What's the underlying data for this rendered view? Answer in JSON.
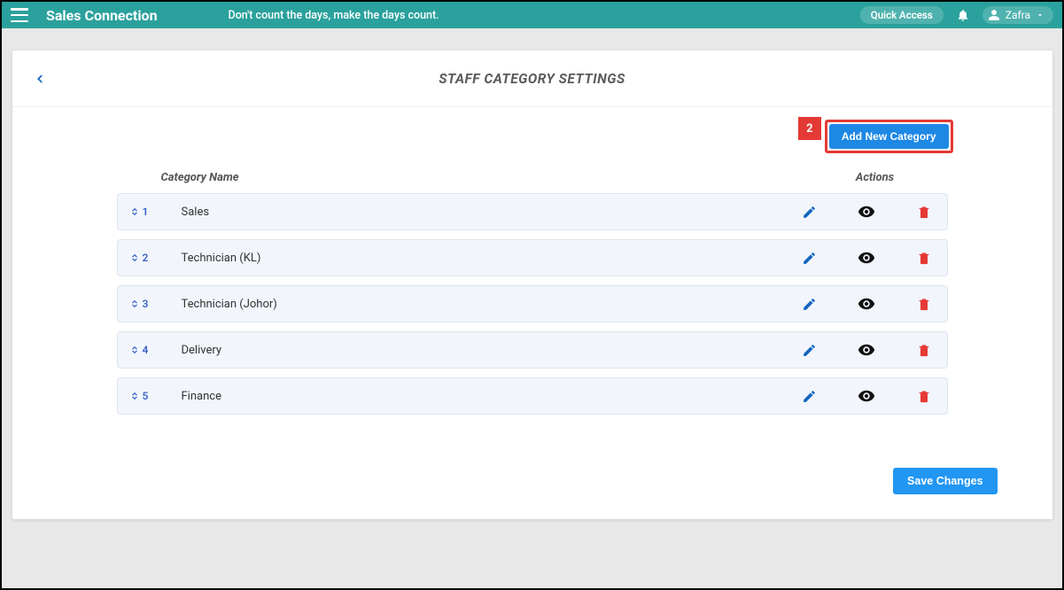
{
  "header": {
    "brand": "Sales Connection",
    "tagline": "Don't count the days, make the days count.",
    "quick_access": "Quick Access",
    "user_name": "Zafra"
  },
  "page": {
    "title": "STAFF CATEGORY SETTINGS",
    "callout_number": "2",
    "add_button": "Add New Category",
    "col_name": "Category Name",
    "col_actions": "Actions",
    "save_button": "Save Changes"
  },
  "categories": [
    {
      "order": "1",
      "name": "Sales"
    },
    {
      "order": "2",
      "name": "Technician (KL)"
    },
    {
      "order": "3",
      "name": "Technician (Johor)"
    },
    {
      "order": "4",
      "name": "Delivery"
    },
    {
      "order": "5",
      "name": "Finance"
    }
  ],
  "colors": {
    "accent": "#2aa19d",
    "primary_btn": "#1e88e5",
    "highlight": "#e53935",
    "row_bg": "#f2f6fc",
    "edit": "#1565c0",
    "delete": "#e53935"
  }
}
